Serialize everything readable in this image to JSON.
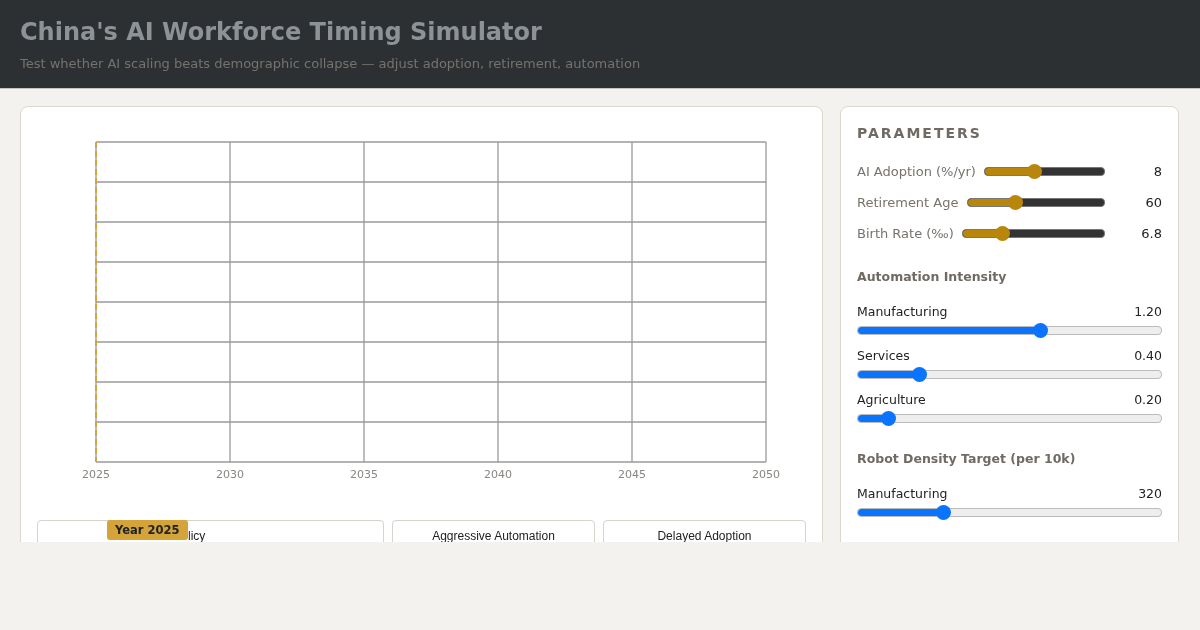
{
  "header": {
    "title": "China's AI Workforce Timing Simulator",
    "subtitle": "Test whether AI scaling beats demographic collapse — adjust adoption, retirement, automation"
  },
  "chart": {
    "x_ticks": [
      "2025",
      "2030",
      "2035",
      "2040",
      "2045",
      "2050"
    ],
    "marker": {
      "label": "Year 2025"
    }
  },
  "scenarios": [
    {
      "label": "licy"
    },
    {
      "label": "Aggressive Automation"
    },
    {
      "label": "Delayed Adoption"
    }
  ],
  "parameters": {
    "title": "PARAMETERS",
    "main": [
      {
        "label": "AI Adoption (%/yr)",
        "value": "8",
        "level": 0.41
      },
      {
        "label": "Retirement Age",
        "value": "60",
        "level": 0.35
      },
      {
        "label": "Birth Rate (‰)",
        "value": "6.8",
        "level": 0.28
      }
    ],
    "sections": [
      {
        "title": "Automation Intensity",
        "sliders": [
          {
            "label": "Manufacturing",
            "value": "1.20",
            "level": 0.6
          },
          {
            "label": "Services",
            "value": "0.40",
            "level": 0.2
          },
          {
            "label": "Agriculture",
            "value": "0.20",
            "level": 0.1
          }
        ]
      },
      {
        "title": "Robot Density Target (per 10k)",
        "sliders": [
          {
            "label": "Manufacturing",
            "value": "320",
            "level": 0.28
          }
        ]
      }
    ]
  }
}
